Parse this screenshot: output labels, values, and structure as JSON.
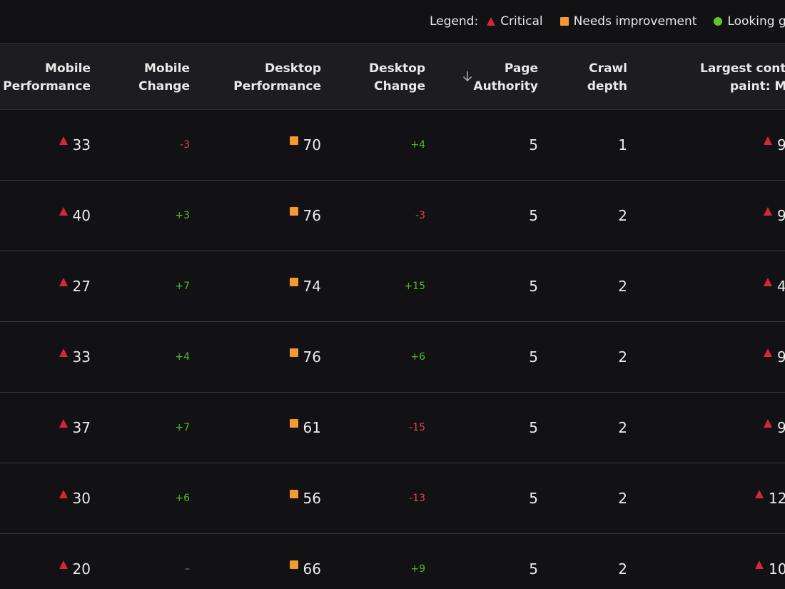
{
  "legend": {
    "label": "Legend:",
    "items": [
      {
        "shape": "triangle",
        "icon": "critical-triangle-icon",
        "label": "Critical",
        "color": "#d8253c"
      },
      {
        "shape": "square",
        "icon": "needs-improvement-square-icon",
        "label": "Needs improvement",
        "color": "#f59a32"
      },
      {
        "shape": "circle",
        "icon": "looking-good-circle-icon",
        "label": "Looking go",
        "color": "#5ec832"
      }
    ]
  },
  "columns": [
    {
      "key": "mobile_perf",
      "line1": "Mobile",
      "line2": "Performance"
    },
    {
      "key": "mobile_change",
      "line1": "Mobile",
      "line2": "Change"
    },
    {
      "key": "desktop_perf",
      "line1": "Desktop",
      "line2": "Performance"
    },
    {
      "key": "desktop_change",
      "line1": "Desktop",
      "line2": "Change"
    },
    {
      "key": "page_authority",
      "line1": "Page",
      "line2": "Authority",
      "sorted": "desc"
    },
    {
      "key": "crawl_depth",
      "line1": "Crawl",
      "line2": "depth"
    },
    {
      "key": "lcp_mobile",
      "line1": "Largest conten",
      "line2": "paint: Mo"
    }
  ],
  "rows": [
    {
      "mobile_perf": "33",
      "mobile_status": "critical",
      "mobile_change": "-3",
      "desktop_perf": "70",
      "desktop_status": "needs-improvement",
      "desktop_change": "+4",
      "page_authority": "5",
      "crawl_depth": "1",
      "lcp_status": "critical",
      "lcp": "9"
    },
    {
      "mobile_perf": "40",
      "mobile_status": "critical",
      "mobile_change": "+3",
      "desktop_perf": "76",
      "desktop_status": "needs-improvement",
      "desktop_change": "-3",
      "page_authority": "5",
      "crawl_depth": "2",
      "lcp_status": "critical",
      "lcp": "9"
    },
    {
      "mobile_perf": "27",
      "mobile_status": "critical",
      "mobile_change": "+7",
      "desktop_perf": "74",
      "desktop_status": "needs-improvement",
      "desktop_change": "+15",
      "page_authority": "5",
      "crawl_depth": "2",
      "lcp_status": "critical",
      "lcp": "4"
    },
    {
      "mobile_perf": "33",
      "mobile_status": "critical",
      "mobile_change": "+4",
      "desktop_perf": "76",
      "desktop_status": "needs-improvement",
      "desktop_change": "+6",
      "page_authority": "5",
      "crawl_depth": "2",
      "lcp_status": "critical",
      "lcp": "9"
    },
    {
      "mobile_perf": "37",
      "mobile_status": "critical",
      "mobile_change": "+7",
      "desktop_perf": "61",
      "desktop_status": "needs-improvement",
      "desktop_change": "-15",
      "page_authority": "5",
      "crawl_depth": "2",
      "lcp_status": "critical",
      "lcp": "9"
    },
    {
      "mobile_perf": "30",
      "mobile_status": "critical",
      "mobile_change": "+6",
      "desktop_perf": "56",
      "desktop_status": "needs-improvement",
      "desktop_change": "-13",
      "page_authority": "5",
      "crawl_depth": "2",
      "lcp_status": "critical",
      "lcp": "12"
    },
    {
      "mobile_perf": "20",
      "mobile_status": "critical",
      "mobile_change": "–",
      "desktop_perf": "66",
      "desktop_status": "needs-improvement",
      "desktop_change": "+9",
      "page_authority": "5",
      "crawl_depth": "2",
      "lcp_status": "critical",
      "lcp": "10"
    }
  ]
}
